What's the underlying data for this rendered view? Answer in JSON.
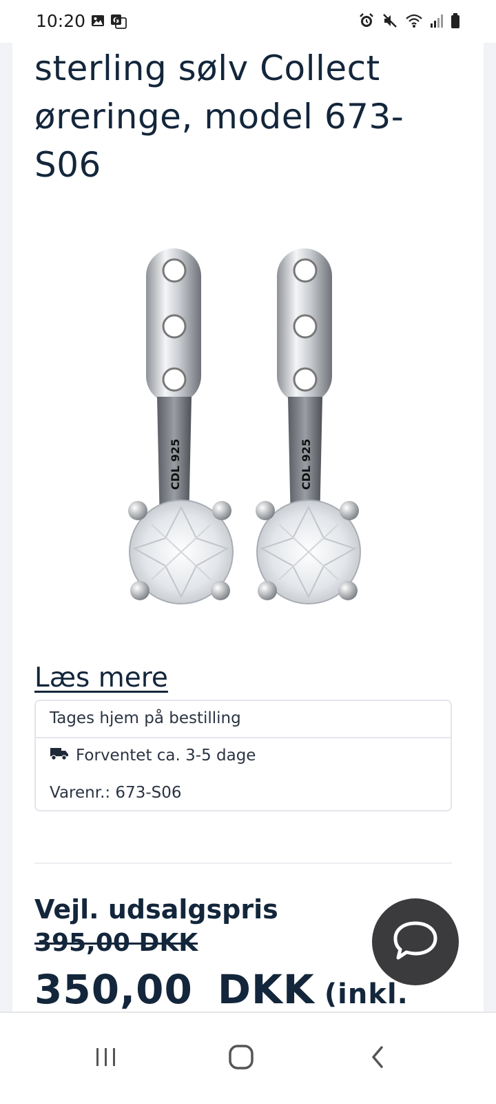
{
  "status_bar": {
    "time": "10:20",
    "left_icons": [
      "gallery-icon",
      "translate-icon"
    ],
    "right_icons": [
      "alarm-icon",
      "mute-icon",
      "wifi-icon",
      "signal-icon",
      "battery-icon"
    ]
  },
  "product": {
    "title": "sterling sølv Collect øreringe, model 673-S06",
    "image": {
      "subject": "earrings-image",
      "engraving": "CDL 925"
    }
  },
  "read_more_label": "Læs mere",
  "info_box": {
    "availability": "Tages hjem på bestilling",
    "delivery_icon": "truck-icon",
    "delivery": "Forventet ca. 3-5 dage",
    "sku": "Varenr.: 673-S06"
  },
  "price": {
    "label": "Vejl. udsalgspris",
    "old_price": "395,00 DKK",
    "current_amount": "350,00",
    "currency": "DKK",
    "suffix": "(inkl."
  },
  "chat_button": {
    "icon": "chat-bubble-icon"
  },
  "nav_bar": {
    "buttons": [
      "recent-apps-icon",
      "home-icon",
      "back-icon"
    ]
  },
  "colors": {
    "text": "#13263b",
    "chat_button": "#3b3b3d",
    "gutter": "#f1f3f6",
    "border": "#e2e5ea"
  }
}
